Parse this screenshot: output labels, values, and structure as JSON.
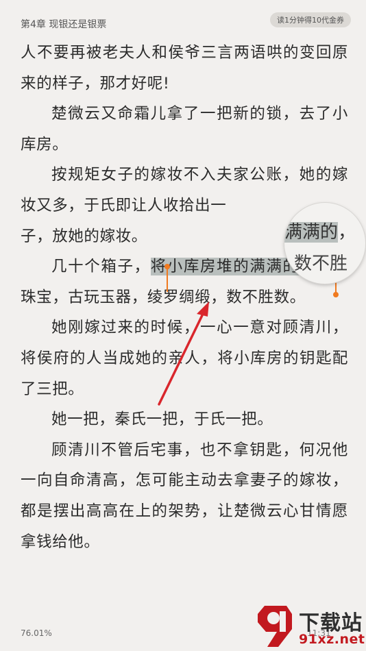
{
  "header": {
    "chapter_title": "第4章 现银还是银票",
    "coin_badge": "读1分钟得10代金券"
  },
  "content": {
    "para1": "人不要再被老夫人和侯爷三言两语哄的变回原来的样子，那才好呢!",
    "para2": "楚微云又命霜儿拿了一把新的锁，去了小库房。",
    "para3": "按规矩女子的嫁妆不入夫家公账，她的嫁妆又多，于氏即让人收拾出一",
    "para3_end": "子，放她的嫁妆。",
    "para4_before": "几十个箱子，",
    "para4_selected": "将小库房堆的满满的",
    "para4_after": "，金银珠宝，古玩玉器，绫罗绸缎，数不胜数。",
    "para5": "她刚嫁过来的时候，一心一意对顾清川，将侯府的人当成她的亲人，将小库房的钥匙配了三把。",
    "para6": "她一把，秦氏一把，于氏一把。",
    "para7": "顾清川不管后宅事，也不拿钥匙，何况他一向自命清高，怎可能主动去拿妻子的嫁妆，都是摆出高高在上的架势，让楚微云心甘情愿拿钱给他。"
  },
  "magnifier": {
    "line1_partial": "满满的",
    "line1_tail": "，",
    "line2": "数不胜"
  },
  "footer": {
    "progress": "76.01%",
    "time": "11:31"
  },
  "watermark": {
    "text1": "下载站",
    "text2": "91xz.net"
  },
  "colors": {
    "selection": "#b9bfbd",
    "cursor": "#f07a1f",
    "arrow": "#d9262c",
    "background": "#f2f0ee"
  }
}
